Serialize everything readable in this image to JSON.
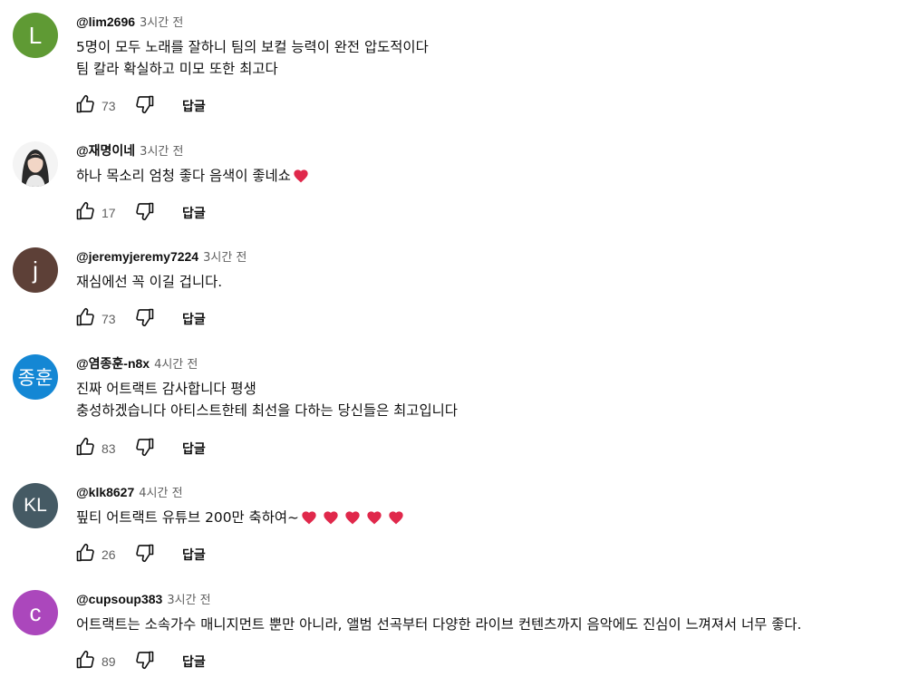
{
  "comments": [
    {
      "author": "@lim2696",
      "time": "3시간 전",
      "avatar": {
        "type": "letter",
        "letter": "L",
        "color": "#5f9a34"
      },
      "lines": [
        "5명이 모두 노래를 잘하니 팀의 보컬 능력이  완전 압도적이다",
        "팀 칼라 확실하고 미모 또한 최고다"
      ],
      "likes": "73",
      "reply_label": "답글"
    },
    {
      "author": "@재명이네",
      "time": "3시간 전",
      "avatar": {
        "type": "photo",
        "icon": "person-photo-icon"
      },
      "lines": [
        "하나 목소리 엄청 좋다 음색이 좋네쇼"
      ],
      "hearts": 1,
      "likes": "17",
      "reply_label": "답글"
    },
    {
      "author": "@jeremyjeremy7224",
      "time": "3시간 전",
      "avatar": {
        "type": "letter",
        "letter": "j",
        "color": "#5d4037"
      },
      "lines": [
        "재심에선 꼭 이길 겁니다."
      ],
      "likes": "73",
      "reply_label": "답글"
    },
    {
      "author": "@염종훈-n8x",
      "time": "4시간 전",
      "avatar": {
        "type": "letter",
        "letter": "종훈",
        "color": "#1487d4"
      },
      "lines": [
        "진짜 어트랙트 감사합니다 평생",
        "충성하겠습니다 아티스트한테 최선을 다하는 당신들은 최고입니다"
      ],
      "likes": "83",
      "reply_label": "답글"
    },
    {
      "author": "@klk8627",
      "time": "4시간 전",
      "avatar": {
        "type": "letter",
        "letter": "KL",
        "color": "#455a64"
      },
      "lines": [
        "핖티 어트랙트 유튜브 200만 축하여~"
      ],
      "hearts": 5,
      "likes": "26",
      "reply_label": "답글"
    },
    {
      "author": "@cupsoup383",
      "time": "3시간 전",
      "avatar": {
        "type": "letter",
        "letter": "c",
        "color": "#ab47bc"
      },
      "lines": [
        "어트랙트는 소속가수 매니지먼트 뿐만 아니라, 앨범 선곡부터 다양한 라이브 컨텐츠까지 음악에도 진심이 느껴져서 너무 좋다."
      ],
      "likes": "89",
      "reply_label": "답글"
    }
  ],
  "icons": {
    "like": "thumbs-up-icon",
    "dislike": "thumbs-down-icon",
    "heart": "red-heart-icon"
  },
  "colors": {
    "text": "#0f0f0f",
    "meta": "#606060",
    "heart": "#e0284b"
  }
}
